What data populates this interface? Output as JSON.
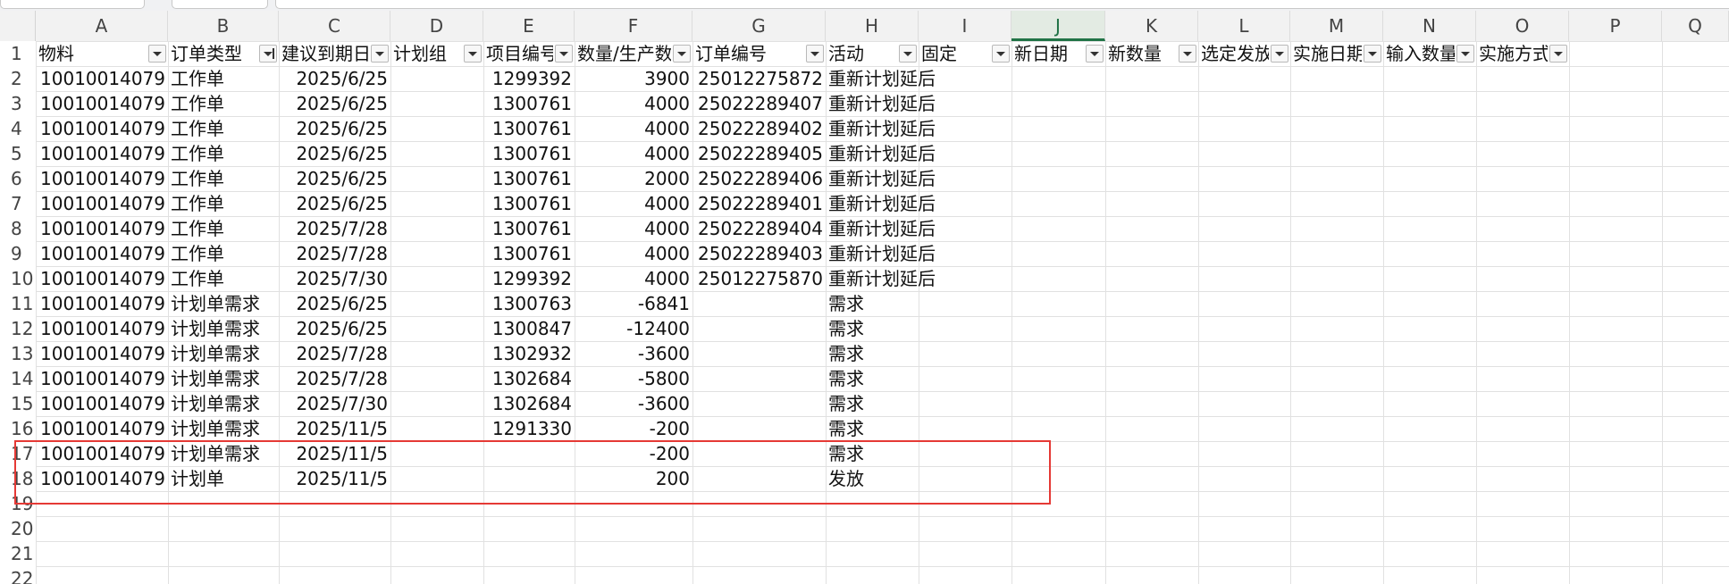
{
  "columns": [
    "A",
    "B",
    "C",
    "D",
    "E",
    "F",
    "G",
    "H",
    "I",
    "J",
    "K",
    "L",
    "M",
    "N",
    "O",
    "P",
    "Q"
  ],
  "active_column": "J",
  "row_numbers": [
    "1",
    "2",
    "3",
    "4",
    "5",
    "6",
    "7",
    "8",
    "9",
    "10",
    "11",
    "12",
    "13",
    "14",
    "15",
    "16",
    "17",
    "18",
    "19",
    "20",
    "21",
    "22"
  ],
  "headers": [
    "物料",
    "订单类型",
    "建议到期日",
    "计划组",
    "项目编号",
    "数量/生产数量",
    "订单编号",
    "活动",
    "固定",
    "新日期",
    "新数量",
    "选定发放",
    "实施日期",
    "输入数量",
    "实施方式"
  ],
  "rows": [
    [
      "10010014079",
      "工作单",
      "2025/6/25",
      "",
      "1299392",
      "3900",
      "25012275872",
      "重新计划延后"
    ],
    [
      "10010014079",
      "工作单",
      "2025/6/25",
      "",
      "1300761",
      "4000",
      "25022289407",
      "重新计划延后"
    ],
    [
      "10010014079",
      "工作单",
      "2025/6/25",
      "",
      "1300761",
      "4000",
      "25022289402",
      "重新计划延后"
    ],
    [
      "10010014079",
      "工作单",
      "2025/6/25",
      "",
      "1300761",
      "4000",
      "25022289405",
      "重新计划延后"
    ],
    [
      "10010014079",
      "工作单",
      "2025/6/25",
      "",
      "1300761",
      "2000",
      "25022289406",
      "重新计划延后"
    ],
    [
      "10010014079",
      "工作单",
      "2025/6/25",
      "",
      "1300761",
      "4000",
      "25022289401",
      "重新计划延后"
    ],
    [
      "10010014079",
      "工作单",
      "2025/7/28",
      "",
      "1300761",
      "4000",
      "25022289404",
      "重新计划延后"
    ],
    [
      "10010014079",
      "工作单",
      "2025/7/28",
      "",
      "1300761",
      "4000",
      "25022289403",
      "重新计划延后"
    ],
    [
      "10010014079",
      "工作单",
      "2025/7/30",
      "",
      "1299392",
      "4000",
      "25012275870",
      "重新计划延后"
    ],
    [
      "10010014079",
      "计划单需求",
      "2025/6/25",
      "",
      "1300763",
      "-6841",
      "",
      "需求"
    ],
    [
      "10010014079",
      "计划单需求",
      "2025/6/25",
      "",
      "1300847",
      "-12400",
      "",
      "需求"
    ],
    [
      "10010014079",
      "计划单需求",
      "2025/7/28",
      "",
      "1302932",
      "-3600",
      "",
      "需求"
    ],
    [
      "10010014079",
      "计划单需求",
      "2025/7/28",
      "",
      "1302684",
      "-5800",
      "",
      "需求"
    ],
    [
      "10010014079",
      "计划单需求",
      "2025/7/30",
      "",
      "1302684",
      "-3600",
      "",
      "需求"
    ],
    [
      "10010014079",
      "计划单需求",
      "2025/11/5",
      "",
      "1291330",
      "-200",
      "",
      "需求"
    ],
    [
      "10010014079",
      "计划单需求",
      "2025/11/5",
      "",
      "",
      "-200",
      "",
      "需求"
    ],
    [
      "10010014079",
      "计划单",
      "2025/11/5",
      "",
      "",
      "200",
      "",
      "发放"
    ]
  ],
  "highlight_color": "#e53935"
}
